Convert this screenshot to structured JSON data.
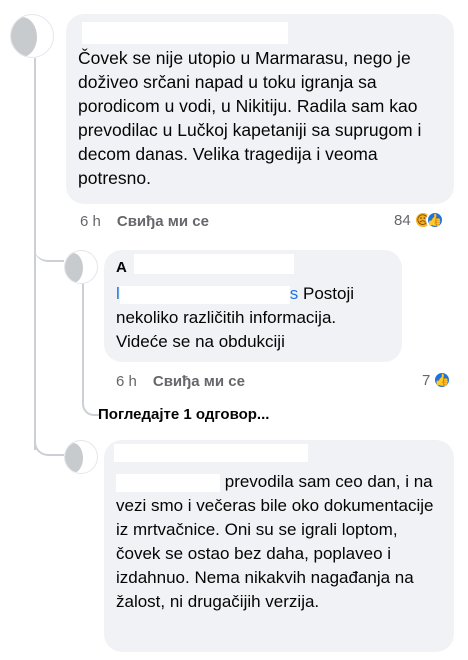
{
  "comment1": {
    "text": "Čovek se nije utopio u Marmarasu, nego je doživeo srčani napad u toku igranja sa porodicom u vodi, u Nikitiju. Radila sam kao prevodilac u Lučkoj kapetaniji sa suprugom i decom danas. Velika tragedija i veoma potresno.",
    "time": "6 h",
    "like_label": "Свиђа ми се",
    "reaction_count": "84",
    "reaction_icons": [
      "sad-emoji-icon",
      "like-icon"
    ]
  },
  "reply1": {
    "name_initial": "A",
    "mention_suffix": "s",
    "text": " Postoji nekoliko različitih informacija. Videće se na obdukciji",
    "time": "6 h",
    "like_label": "Свиђа ми се",
    "reaction_count": "7",
    "reaction_icons": [
      "like-icon"
    ],
    "view_more": "Погледајте 1 одговор..."
  },
  "reply2": {
    "text": "prevodila sam ceo dan, i na vezi smo i večeras bile oko dokumentacije iz mrtvačnice. Oni su se igrali loptom, čovek se ostao bez daha, poplaveo i izdahnuo. Nema nikakvih nagađanja na žalost, ni drugačijih verzija."
  },
  "colors": {
    "mention": "#1b74e4",
    "bubble": "#f0f2f5",
    "meta": "#65676b"
  }
}
